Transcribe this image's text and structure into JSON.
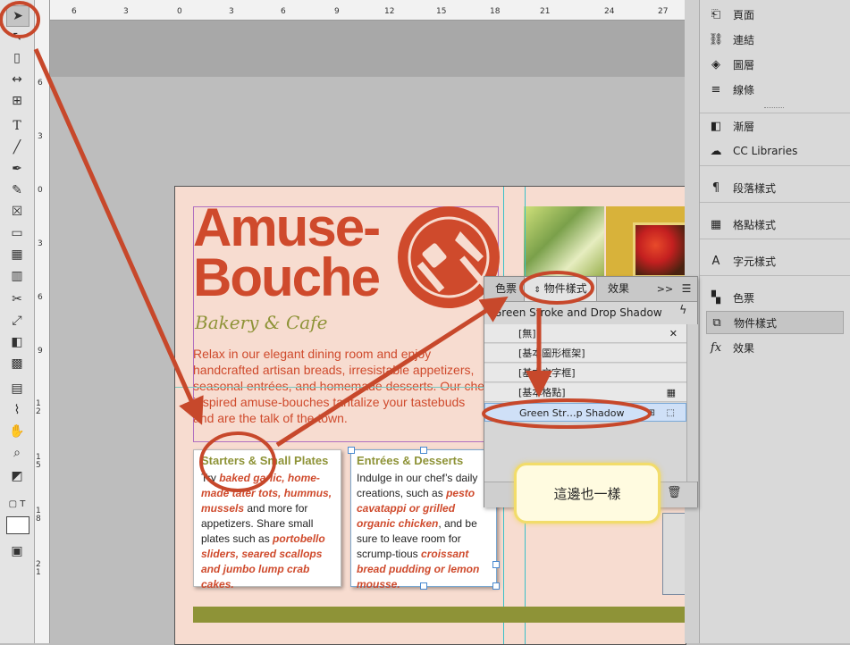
{
  "ruler": {
    "h_labels": [
      "6",
      "3",
      "0",
      "3",
      "6",
      "9",
      "12",
      "15",
      "18",
      "21",
      "24",
      "27"
    ],
    "v_labels": [
      "6",
      "3",
      "0",
      "3",
      "6",
      "9",
      "1 2",
      "1 5",
      "1 8",
      "2 1"
    ]
  },
  "document": {
    "title_line1": "Amuse-",
    "title_line2": "Bouche",
    "subtitle": "Bakery & Cafe",
    "intro": "Relax in our elegant dining room and enjoy handcrafted artisan breads, irresistable appetizers, seasonal entrées, and homemade desserts. Our chef inspired amuse-bouches tantalize your tastebuds and are the talk of the town.",
    "box1": {
      "heading": "Starters & Small Plates",
      "t1": "Try ",
      "i1": "baked garlic, home-made tater tots, hummus, mussels",
      "t2": " and more for appetizers. Share small plates such as ",
      "i2": "portobello sliders, seared scallops and jumbo lump crab cakes."
    },
    "box2": {
      "heading": "Entrées & Desserts",
      "t1": "Indulge in our chef’s daily creations, such as ",
      "i1": "pesto cavatappi or grilled organic chicken",
      "t2": ", and be sure to leave room for scrump-tious ",
      "i2": "croissant bread pudding or lemon mousse."
    },
    "colors": {
      "accent": "#cf4a2c",
      "olive": "#8e9337",
      "paper": "#f7dcd0"
    }
  },
  "right_panel": {
    "items": [
      {
        "label": "頁面",
        "icon": "pages-icon"
      },
      {
        "label": "連結",
        "icon": "links-icon"
      },
      {
        "label": "圖層",
        "icon": "layers-icon"
      },
      {
        "label": "線條",
        "icon": "stroke-icon"
      },
      {
        "label": "漸層",
        "icon": "gradient-icon"
      },
      {
        "label": "CC Libraries",
        "icon": "cc-libraries-icon"
      },
      {
        "label": "段落樣式",
        "icon": "paragraph-styles-icon"
      },
      {
        "label": "格點樣式",
        "icon": "grid-styles-icon"
      },
      {
        "label": "字元樣式",
        "icon": "character-styles-icon"
      },
      {
        "label": "色票",
        "icon": "swatches-icon"
      },
      {
        "label": "物件樣式",
        "icon": "object-styles-icon"
      },
      {
        "label": "效果",
        "icon": "effects-icon"
      }
    ]
  },
  "object_panel": {
    "tabs": [
      "色票",
      "物件樣式",
      "效果"
    ],
    "more": ">>",
    "current_style": "Green Stroke and Drop Shadow",
    "rows": [
      "[無]",
      "[基本圖形框架]",
      "[基本文字框]",
      "[基本格點]",
      "Green Str…p Shadow"
    ]
  },
  "callout": {
    "text": "這邊也一樣"
  }
}
